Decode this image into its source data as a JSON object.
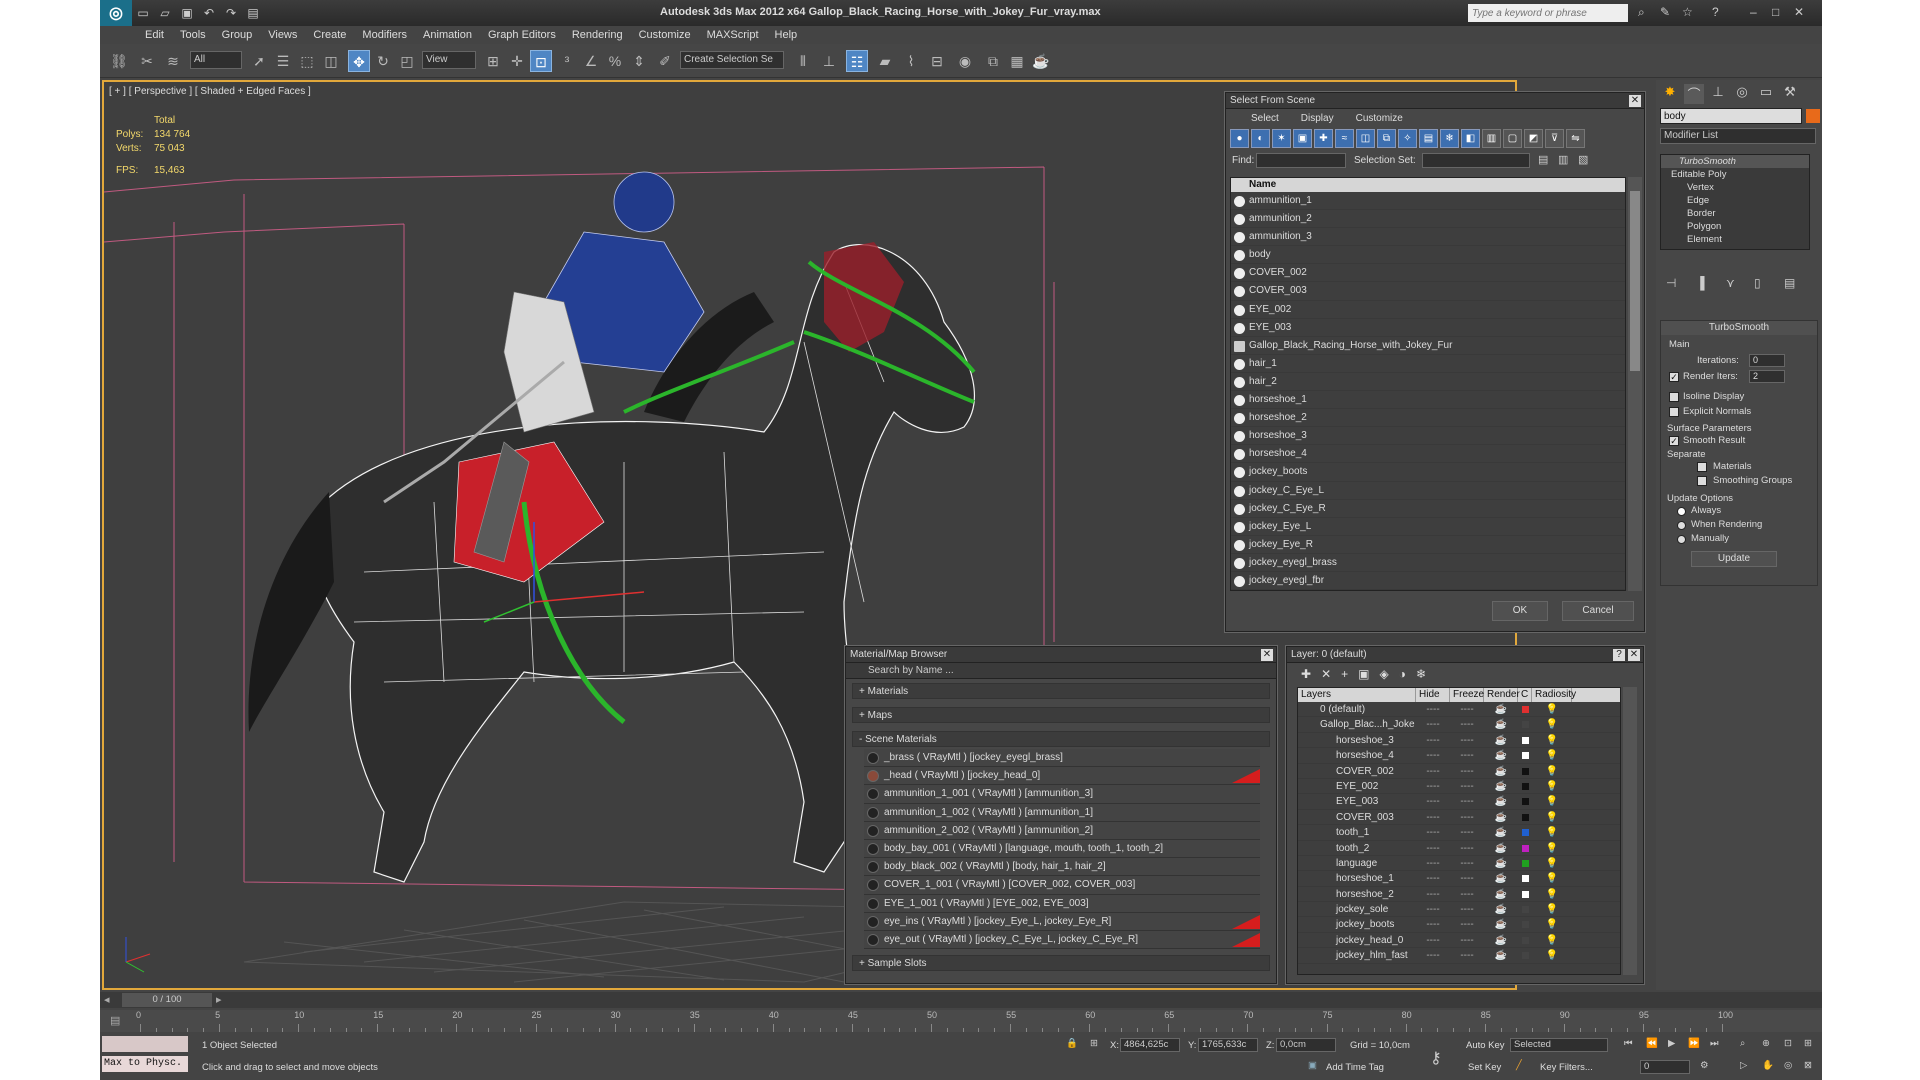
{
  "app": {
    "title": "Autodesk 3ds Max  2012 x64     Gallop_Black_Racing_Horse_with_Jokey_Fur_vray.max",
    "logo": "3ds-max-logo",
    "search_placeholder": "Type a keyword or phrase"
  },
  "menu": [
    "Edit",
    "Tools",
    "Group",
    "Views",
    "Create",
    "Modifiers",
    "Animation",
    "Graph Editors",
    "Rendering",
    "Customize",
    "MAXScript",
    "Help"
  ],
  "toolbar": {
    "selection_filter": "All",
    "ref_coord": "View",
    "named_selection": "Create Selection Se"
  },
  "viewport": {
    "label": "[ + ] [ Perspective ] [ Shaded + Edged Faces ]",
    "stats": {
      "total_label": "Total",
      "polys_label": "Polys:",
      "polys": "134 764",
      "verts_label": "Verts:",
      "verts": "75 043",
      "fps_label": "FPS:",
      "fps": "15,463"
    }
  },
  "select_from_scene": {
    "title": "Select From Scene",
    "menu": [
      "Select",
      "Display",
      "Customize"
    ],
    "find_label": "Find:",
    "selection_set_label": "Selection Set:",
    "column": "Name",
    "objects": [
      "ammunition_1",
      "ammunition_2",
      "ammunition_3",
      "body",
      "COVER_002",
      "COVER_003",
      "EYE_002",
      "EYE_003",
      "Gallop_Black_Racing_Horse_with_Jokey_Fur",
      "hair_1",
      "hair_2",
      "horseshoe_1",
      "horseshoe_2",
      "horseshoe_3",
      "horseshoe_4",
      "jockey_boots",
      "jockey_C_Eye_L",
      "jockey_C_Eye_R",
      "jockey_Eye_L",
      "jockey_Eye_R",
      "jockey_eyegl_brass",
      "jockey_eyegl_fbr"
    ],
    "ok": "OK",
    "cancel": "Cancel"
  },
  "material_browser": {
    "title": "Material/Map Browser",
    "search": "Search by Name ...",
    "groups": [
      "+ Materials",
      "+ Maps",
      "- Scene Materials"
    ],
    "materials": [
      "_brass  ( VRayMtl )  [jockey_eyegl_brass]",
      "_head  ( VRayMtl )  [jockey_head_0]",
      "ammunition_1_001  ( VRayMtl )  [ammunition_3]",
      "ammunition_1_002  ( VRayMtl )  [ammunition_1]",
      "ammunition_2_002  ( VRayMtl )  [ammunition_2]",
      "body_bay_001  ( VRayMtl )  [language, mouth, tooth_1, tooth_2]",
      "body_black_002  ( VRayMtl )  [body, hair_1, hair_2]",
      "COVER_1_001  ( VRayMtl )  [COVER_002, COVER_003]",
      "EYE_1_001  ( VRayMtl )  [EYE_002, EYE_003]",
      "eye_ins  ( VRayMtl )  [jockey_Eye_L, jockey_Eye_R]",
      "eye_out  ( VRayMtl )  [jockey_C_Eye_L, jockey_C_Eye_R]"
    ],
    "sample_slots": "+ Sample Slots"
  },
  "layer_manager": {
    "title": "Layer: 0 (default)",
    "columns": [
      "Layers",
      "Hide",
      "Freeze",
      "Render",
      "C",
      "Radiosity"
    ],
    "layers": [
      {
        "name": "0 (default)",
        "color": "#e03030",
        "top": true
      },
      {
        "name": "Gallop_Blac...h_Joke",
        "color": "#444444",
        "top": true
      },
      {
        "name": "horseshoe_3",
        "color": "#ffffff"
      },
      {
        "name": "horseshoe_4",
        "color": "#ffffff"
      },
      {
        "name": "COVER_002",
        "color": "#111111"
      },
      {
        "name": "EYE_002",
        "color": "#111111"
      },
      {
        "name": "EYE_003",
        "color": "#111111"
      },
      {
        "name": "COVER_003",
        "color": "#111111"
      },
      {
        "name": "tooth_1",
        "color": "#2060d0"
      },
      {
        "name": "tooth_2",
        "color": "#c020c0"
      },
      {
        "name": "language",
        "color": "#20a020"
      },
      {
        "name": "horseshoe_1",
        "color": "#ffffff"
      },
      {
        "name": "horseshoe_2",
        "color": "#ffffff"
      },
      {
        "name": "jockey_sole",
        "color": "#444444"
      },
      {
        "name": "jockey_boots",
        "color": "#444444"
      },
      {
        "name": "jockey_head_0",
        "color": "#444444"
      },
      {
        "name": "jockey_hlm_fast",
        "color": "#444444"
      }
    ],
    "dashes": "----"
  },
  "command_panel": {
    "object_name": "body",
    "modifier_list": "Modifier List",
    "stack": [
      "TurboSmooth",
      "Editable Poly",
      "Vertex",
      "Edge",
      "Border",
      "Polygon",
      "Element"
    ],
    "turbosmooth": {
      "title": "TurboSmooth",
      "main": "Main",
      "iterations_label": "Iterations:",
      "iterations": "0",
      "render_iters_label": "Render Iters:",
      "render_iters": "2",
      "isoline": "Isoline Display",
      "explicit_normals": "Explicit Normals",
      "surface_params": "Surface Parameters",
      "smooth_result": "Smooth Result",
      "separate": "Separate",
      "materials": "Materials",
      "smoothing_groups": "Smoothing Groups",
      "update_options": "Update Options",
      "always": "Always",
      "when_rendering": "When Rendering",
      "manually": "Manually",
      "update": "Update"
    }
  },
  "timeline": {
    "slider": "0 / 100",
    "ticks": [
      "0",
      "5",
      "10",
      "15",
      "20",
      "25",
      "30",
      "35",
      "40",
      "45",
      "50",
      "55",
      "60",
      "65",
      "70",
      "75",
      "80",
      "85",
      "90",
      "95",
      "100"
    ]
  },
  "status": {
    "maxscript": "Max to Physc.",
    "selected": "1 Object Selected",
    "prompt": "Click and drag to select and move objects",
    "x_label": "X:",
    "x": "4864,625c",
    "y_label": "Y:",
    "y": "1765,633c",
    "z_label": "Z:",
    "z": "0,0cm",
    "grid": "Grid = 10,0cm",
    "add_time_tag": "Add Time Tag",
    "auto_key": "Auto Key",
    "set_key": "Set Key",
    "key_mode": "Selected",
    "key_filters": "Key Filters...",
    "frame": "0"
  }
}
